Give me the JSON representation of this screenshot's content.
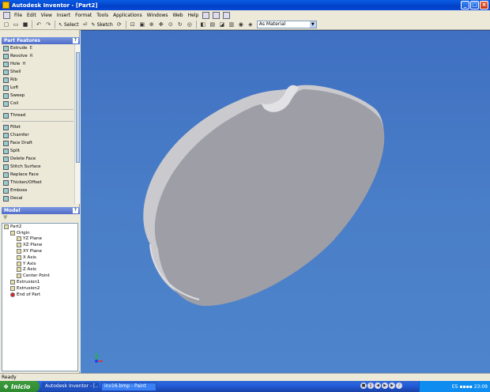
{
  "window": {
    "title": "Autodesk Inventor - [Part2]"
  },
  "menu": [
    "File",
    "Edit",
    "View",
    "Insert",
    "Format",
    "Tools",
    "Applications",
    "Windows",
    "Web",
    "Help"
  ],
  "toolbar": {
    "select_label": "Select",
    "sketch_label": "Sketch",
    "material_value": "As Material"
  },
  "features_panel": {
    "title": "Part Features",
    "items": [
      {
        "label": "Extrude",
        "shortcut": "E"
      },
      {
        "label": "Revolve",
        "shortcut": "R"
      },
      {
        "label": "Hole",
        "shortcut": "H"
      },
      {
        "label": "Shell",
        "shortcut": ""
      },
      {
        "label": "Rib",
        "shortcut": ""
      },
      {
        "label": "Loft",
        "shortcut": ""
      },
      {
        "label": "Sweep",
        "shortcut": ""
      },
      {
        "label": "Coil",
        "shortcut": ""
      },
      {
        "label": "Thread",
        "shortcut": ""
      },
      {
        "label": "Fillet",
        "shortcut": ""
      },
      {
        "label": "Chamfer",
        "shortcut": ""
      },
      {
        "label": "Face Draft",
        "shortcut": ""
      },
      {
        "label": "Split",
        "shortcut": ""
      },
      {
        "label": "Delete Face",
        "shortcut": ""
      },
      {
        "label": "Stitch Surface",
        "shortcut": ""
      },
      {
        "label": "Replace Face",
        "shortcut": ""
      },
      {
        "label": "Thicken/Offset",
        "shortcut": ""
      },
      {
        "label": "Emboss",
        "shortcut": ""
      },
      {
        "label": "Decal",
        "shortcut": ""
      }
    ]
  },
  "model_panel": {
    "title": "Model",
    "tree": [
      {
        "label": "Part2",
        "level": 0
      },
      {
        "label": "Origin",
        "level": 1
      },
      {
        "label": "YZ Plane",
        "level": 2
      },
      {
        "label": "XZ Plane",
        "level": 2
      },
      {
        "label": "XY Plane",
        "level": 2
      },
      {
        "label": "X Axis",
        "level": 2
      },
      {
        "label": "Y Axis",
        "level": 2
      },
      {
        "label": "Z Axis",
        "level": 2
      },
      {
        "label": "Center Point",
        "level": 2
      },
      {
        "label": "Extrusion1",
        "level": 1
      },
      {
        "label": "Extrusion2",
        "level": 1
      },
      {
        "label": "End of Part",
        "level": 1
      }
    ]
  },
  "status": {
    "text": "Ready"
  },
  "taskbar": {
    "start": "Inicio",
    "tasks": [
      "Autodesk Inventor - [...",
      "inv16.bmp - Paint"
    ],
    "lang": "ES",
    "clock": "23:09"
  }
}
